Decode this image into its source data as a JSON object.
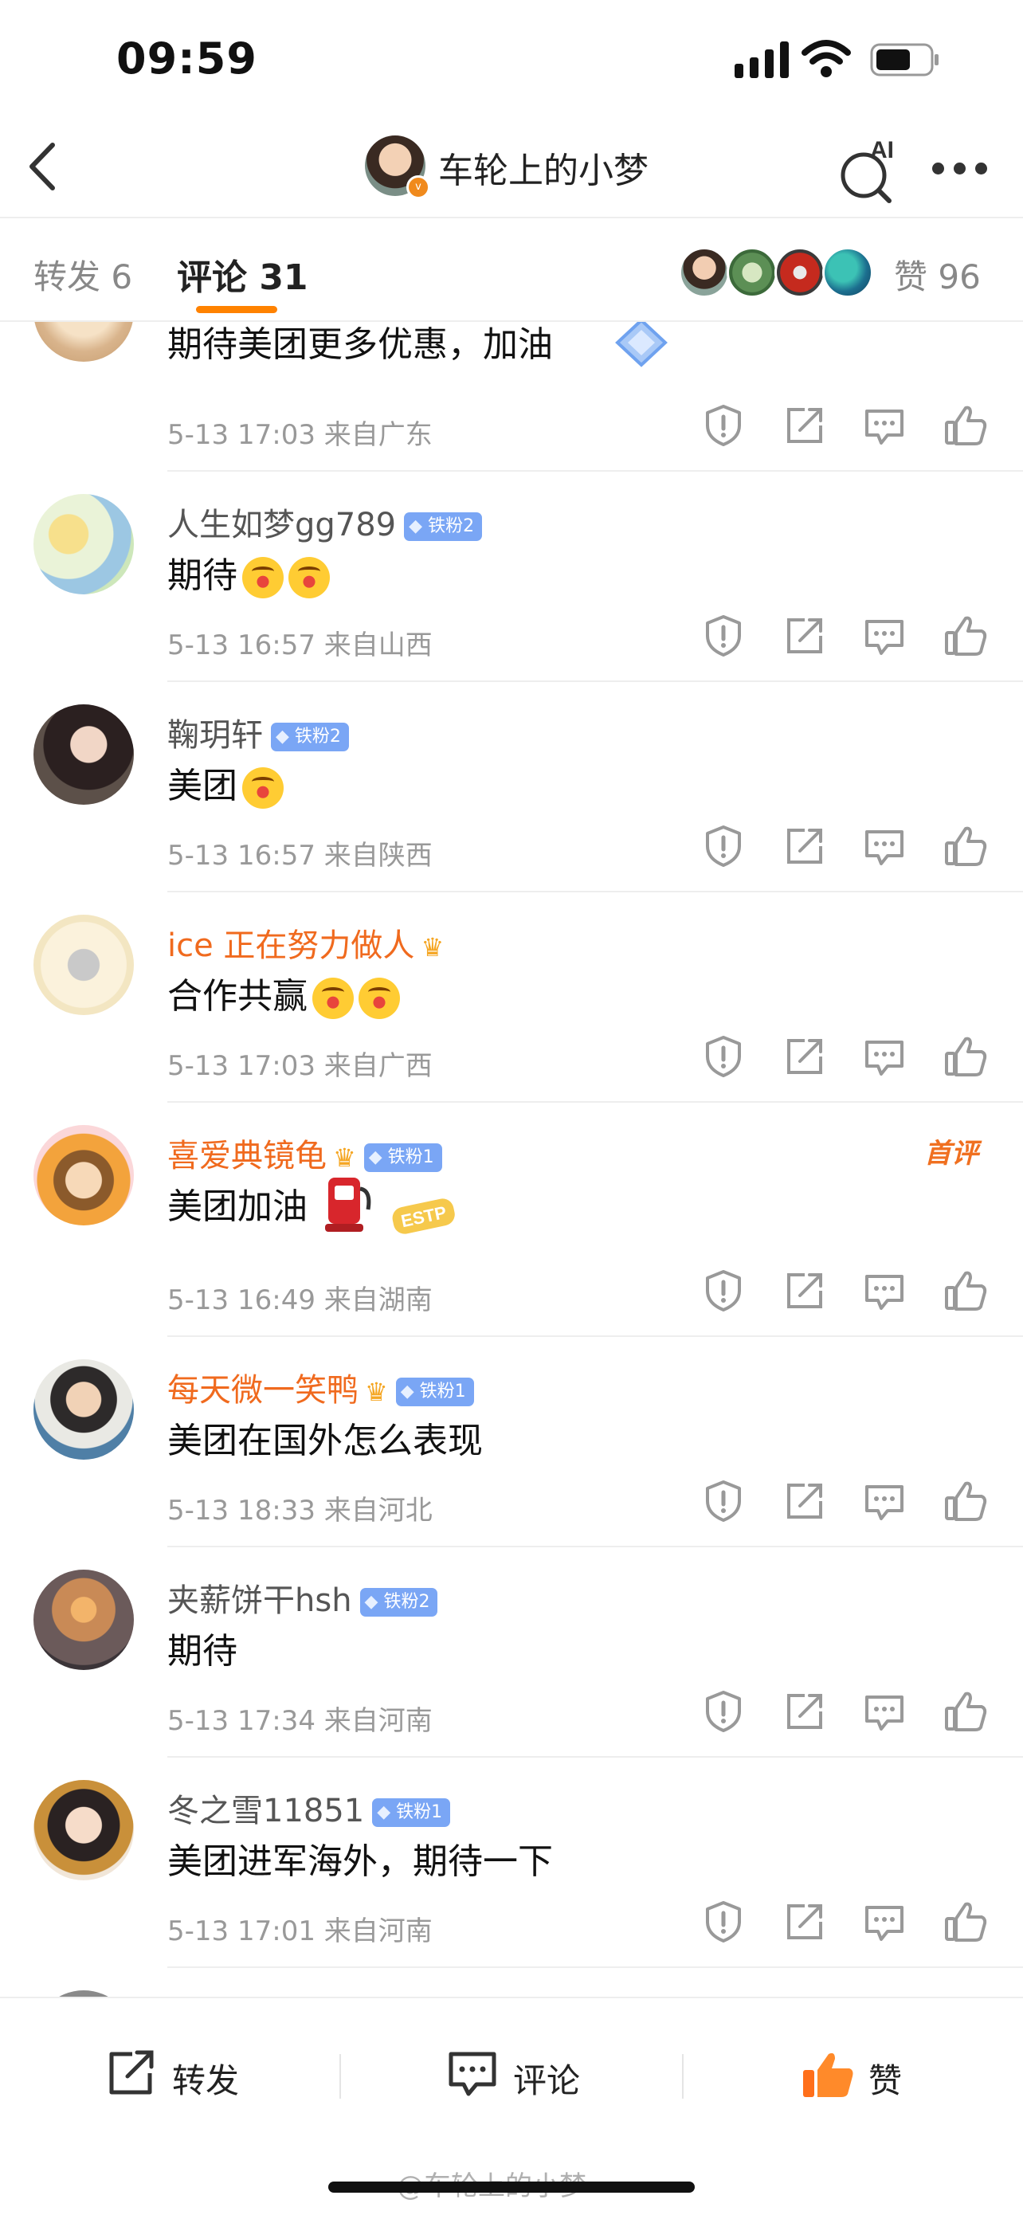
{
  "status_bar": {
    "time": "09:59"
  },
  "header": {
    "title": "车轮上的小梦",
    "ai_label": "AI"
  },
  "tabs": {
    "repost": "转发 6",
    "comments": "评论 31",
    "likes_label": "赞",
    "likes_count": "96"
  },
  "comments": [
    {
      "name": "",
      "text": "期待美团更多优惠，加油",
      "time": "5-13 17:03",
      "location": "来自广东"
    },
    {
      "name": "人生如梦gg789",
      "badge": "铁粉2",
      "text": "期待",
      "time": "5-13 16:57",
      "location": "来自山西"
    },
    {
      "name": "鞠玥轩",
      "badge": "铁粉2",
      "text": "美团",
      "time": "5-13 16:57",
      "location": "来自陕西"
    },
    {
      "name": "ice 正在努力做人",
      "text": "合作共赢",
      "time": "5-13 17:03",
      "location": "来自广西"
    },
    {
      "name": "喜爱典镜龟",
      "badge": "铁粉1",
      "tag": "首评",
      "text": "美团加油",
      "sticker": "ESTP",
      "time": "5-13 16:49",
      "location": "来自湖南"
    },
    {
      "name": "每天微一笑鸭",
      "badge": "铁粉1",
      "text": "美团在国外怎么表现",
      "time": "5-13 18:33",
      "location": "来自河北"
    },
    {
      "name": "夹薪饼干hsh",
      "badge": "铁粉2",
      "text": "期待",
      "time": "5-13 17:34",
      "location": "来自河南"
    },
    {
      "name": "冬之雪11851",
      "badge": "铁粉1",
      "text": "美团进军海外，期待一下",
      "time": "5-13 17:01",
      "location": "来自河南"
    }
  ],
  "bottom_bar": {
    "repost": "转发",
    "comment": "评论",
    "like": "赞"
  },
  "watermark": "@车轮上的小梦",
  "colors": {
    "accent": "#ff8200",
    "orange_name": "#f06a1e",
    "badge_blue": "#7aa6f5"
  }
}
